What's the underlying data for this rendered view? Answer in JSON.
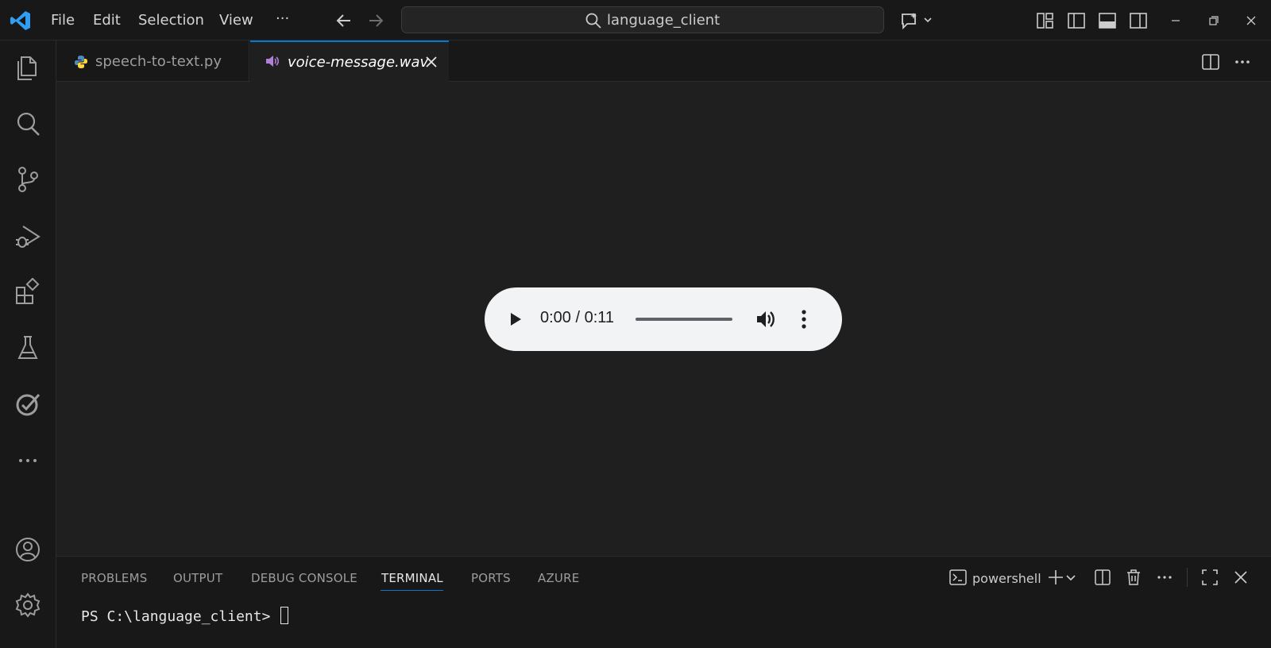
{
  "menu": {
    "items": [
      "File",
      "Edit",
      "Selection",
      "View"
    ],
    "more": "···"
  },
  "search": {
    "text": "language_client"
  },
  "tabs": [
    {
      "label": "speech-to-text.py",
      "icon": "python-icon"
    },
    {
      "label": "voice-message.wav",
      "icon": "speaker-icon",
      "active": true
    }
  ],
  "player": {
    "time": "0:00 / 0:11",
    "progress": 0
  },
  "panel": {
    "tabs": [
      "PROBLEMS",
      "OUTPUT",
      "DEBUG CONSOLE",
      "TERMINAL",
      "PORTS",
      "AZURE"
    ],
    "active_tab": "TERMINAL",
    "shell": "powershell",
    "prompt": "PS C:\\language_client> "
  },
  "colors": {
    "accent": "#0078d4",
    "background": "#1f1f1f",
    "chrome": "#181818"
  }
}
